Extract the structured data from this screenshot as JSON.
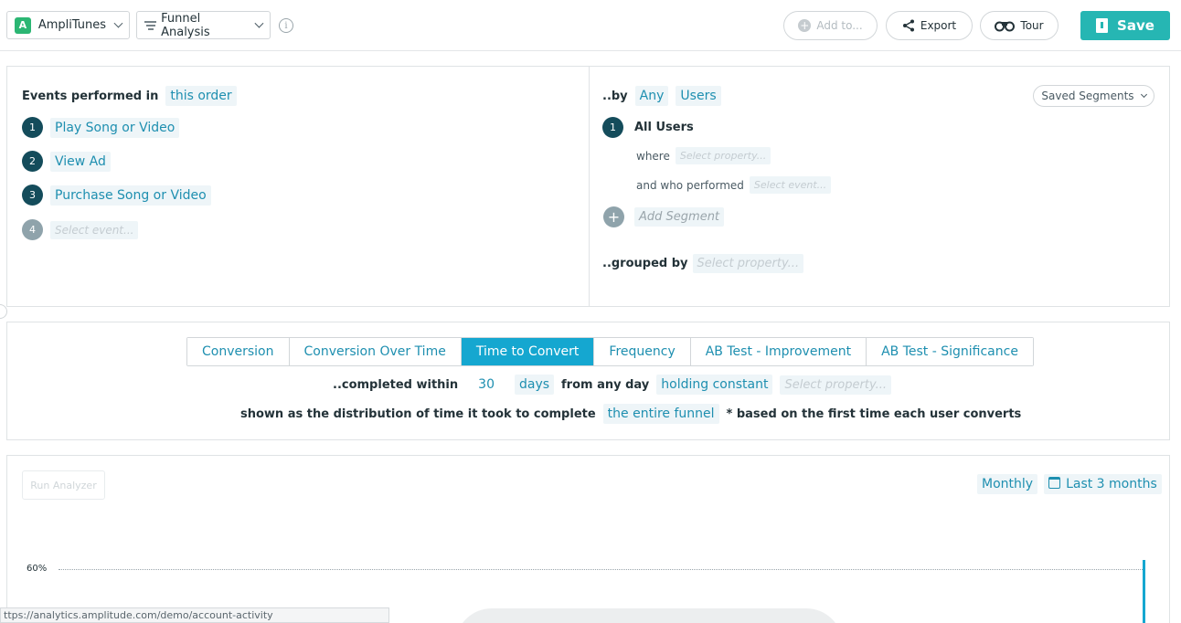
{
  "topbar": {
    "app_badge": "A",
    "app_name": "AmpliTunes",
    "chart_type": "Funnel Analysis",
    "add_to_label": "Add to...",
    "export_label": "Export",
    "tour_label": "Tour",
    "save_label": "Save"
  },
  "events_panel": {
    "title": "Events performed in",
    "order_chip": "this order",
    "events": [
      {
        "num": "1",
        "label": "Play Song or Video"
      },
      {
        "num": "2",
        "label": "View Ad"
      },
      {
        "num": "3",
        "label": "Purchase Song or Video"
      }
    ],
    "placeholder_num": "4",
    "placeholder": "Select event..."
  },
  "segment_panel": {
    "by_label": "..by",
    "any_chip": "Any",
    "users_chip": "Users",
    "saved_segments": "Saved Segments",
    "segment_num": "1",
    "segment_name": "All Users",
    "where_label": "where",
    "where_placeholder": "Select property...",
    "who_performed_label": "and who performed",
    "who_performed_placeholder": "Select event...",
    "add_segment": "Add Segment",
    "grouped_by_label": "..grouped by",
    "grouped_by_placeholder": "Select property..."
  },
  "tabs": [
    {
      "label": "Conversion",
      "active": false
    },
    {
      "label": "Conversion Over Time",
      "active": false
    },
    {
      "label": "Time to Convert",
      "active": true
    },
    {
      "label": "Frequency",
      "active": false
    },
    {
      "label": "AB Test - Improvement",
      "active": false
    },
    {
      "label": "AB Test - Significance",
      "active": false
    }
  ],
  "settings": {
    "completed_within": "..completed within",
    "days_value": "30",
    "days_unit": "days",
    "from_any_day": "from any day",
    "holding_constant": "holding constant",
    "holding_placeholder": "Select property...",
    "shown_as": "shown as the distribution of time it took to complete",
    "funnel_chip": "the entire funnel",
    "note": "* based on the first time each user converts"
  },
  "chart_area": {
    "run_analyzer": "Run Analyzer",
    "interval": "Monthly",
    "range": "Last 3 months",
    "y_tick": "60%"
  },
  "status_bar": {
    "url": "ttps://analytics.amplitude.com/demo/account-activity"
  }
}
